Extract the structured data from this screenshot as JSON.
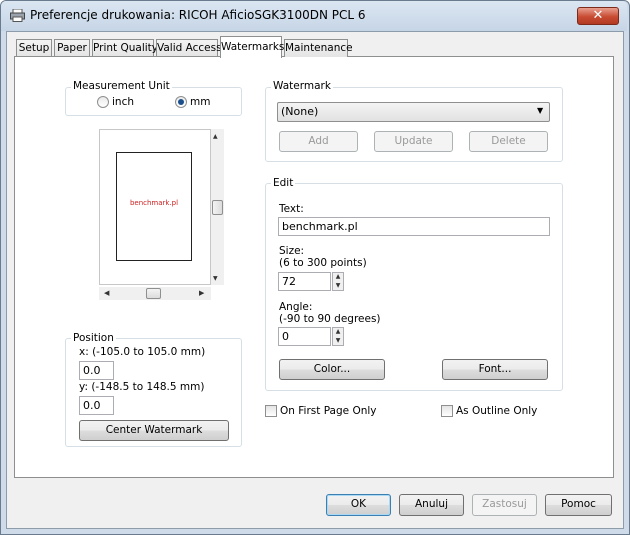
{
  "window": {
    "title": "Preferencje drukowania: RICOH AficioSGK3100DN PCL 6",
    "close_glyph": "✕"
  },
  "tabs": [
    {
      "label": "Setup"
    },
    {
      "label": "Paper"
    },
    {
      "label": "Print Quality"
    },
    {
      "label": "Valid Access"
    },
    {
      "label": "Watermarks",
      "active": true
    },
    {
      "label": "Maintenance"
    }
  ],
  "measurement": {
    "legend": "Measurement Unit",
    "inch": "inch",
    "mm": "mm",
    "selected": "mm"
  },
  "preview": {
    "watermark_text": "benchmark.pl",
    "watermark_color": "#cc2222"
  },
  "position": {
    "legend": "Position",
    "x_label": "x: (-105.0 to 105.0 mm)",
    "x_value": "0.0",
    "y_label": "y: (-148.5 to 148.5 mm)",
    "y_value": "0.0",
    "center_button": "Center Watermark"
  },
  "watermark": {
    "legend": "Watermark",
    "selected": "(None)",
    "add": "Add",
    "update": "Update",
    "delete": "Delete"
  },
  "edit": {
    "legend": "Edit",
    "text_label": "Text:",
    "text_value": "benchmark.pl",
    "size_label": "Size:",
    "size_range": "(6 to 300 points)",
    "size_value": "72",
    "angle_label": "Angle:",
    "angle_range": "(-90 to 90 degrees)",
    "angle_value": "0",
    "color_button": "Color...",
    "font_button": "Font..."
  },
  "options": {
    "first_page_only": "On First Page Only",
    "outline_only": "As Outline Only"
  },
  "footer": {
    "ok": "OK",
    "cancel": "Anuluj",
    "apply": "Zastosuj",
    "help": "Pomoc"
  }
}
